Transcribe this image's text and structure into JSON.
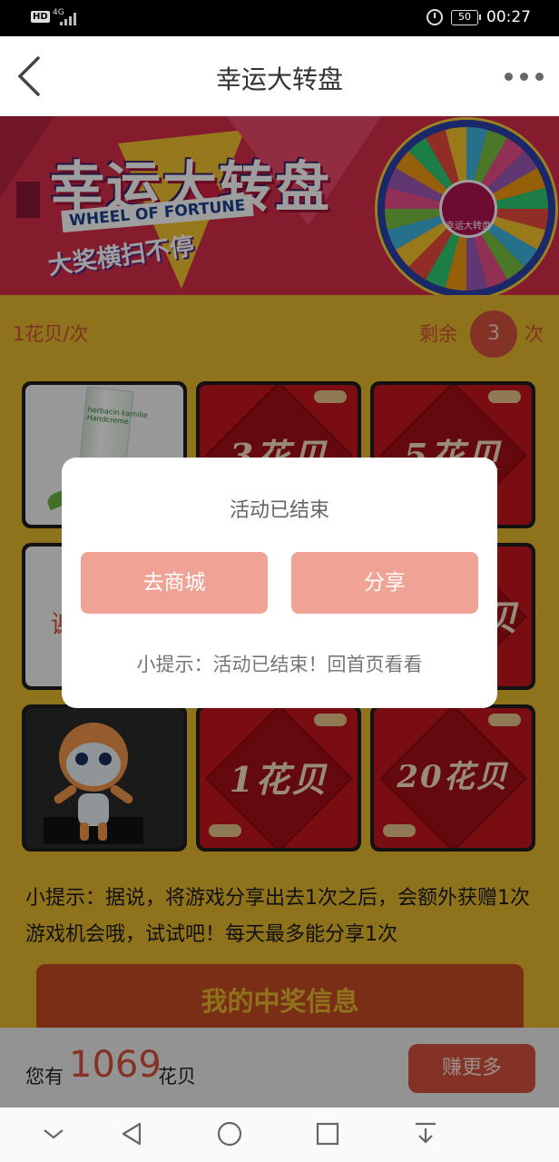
{
  "status_bar": {
    "hd": "HD",
    "network": "4G",
    "battery": "50",
    "time": "00:27"
  },
  "header": {
    "title": "幸运大转盘"
  },
  "banner": {
    "title": "幸运大转盘",
    "subtitle_en": "WHEEL OF FORTUNE",
    "slogan": "大奖横扫不停",
    "wheel_center": "幸运大转盘"
  },
  "game_info": {
    "cost": "1花贝/次",
    "remaining_label": "剩余",
    "remaining_count": "3",
    "remaining_unit": "次"
  },
  "prizes": [
    {
      "label": "",
      "type": "product",
      "text": "herbacin kamille Handcreme"
    },
    {
      "label": "3花贝",
      "type": "huabei"
    },
    {
      "label": "5花贝",
      "type": "huabei"
    },
    {
      "label": "谢",
      "type": "partial"
    },
    {
      "label": "",
      "type": "hidden"
    },
    {
      "label": "贝",
      "type": "partial"
    },
    {
      "label": "",
      "type": "toy"
    },
    {
      "label": "1花贝",
      "type": "huabei"
    },
    {
      "label": "20花贝",
      "type": "huabei"
    }
  ],
  "tip": "小提示：据说，将游戏分享出去1次之后，会额外获赠1次游戏机会哦，试试吧！每天最多能分享1次",
  "my_prize_button": "我的中奖信息",
  "bottom_bar": {
    "prefix": "您有",
    "amount": "1069",
    "unit": "花贝",
    "earn_button": "赚更多"
  },
  "modal": {
    "title": "活动已结束",
    "mall_button": "去商城",
    "share_button": "分享",
    "tip": "小提示：活动已结束！回首页看看"
  }
}
